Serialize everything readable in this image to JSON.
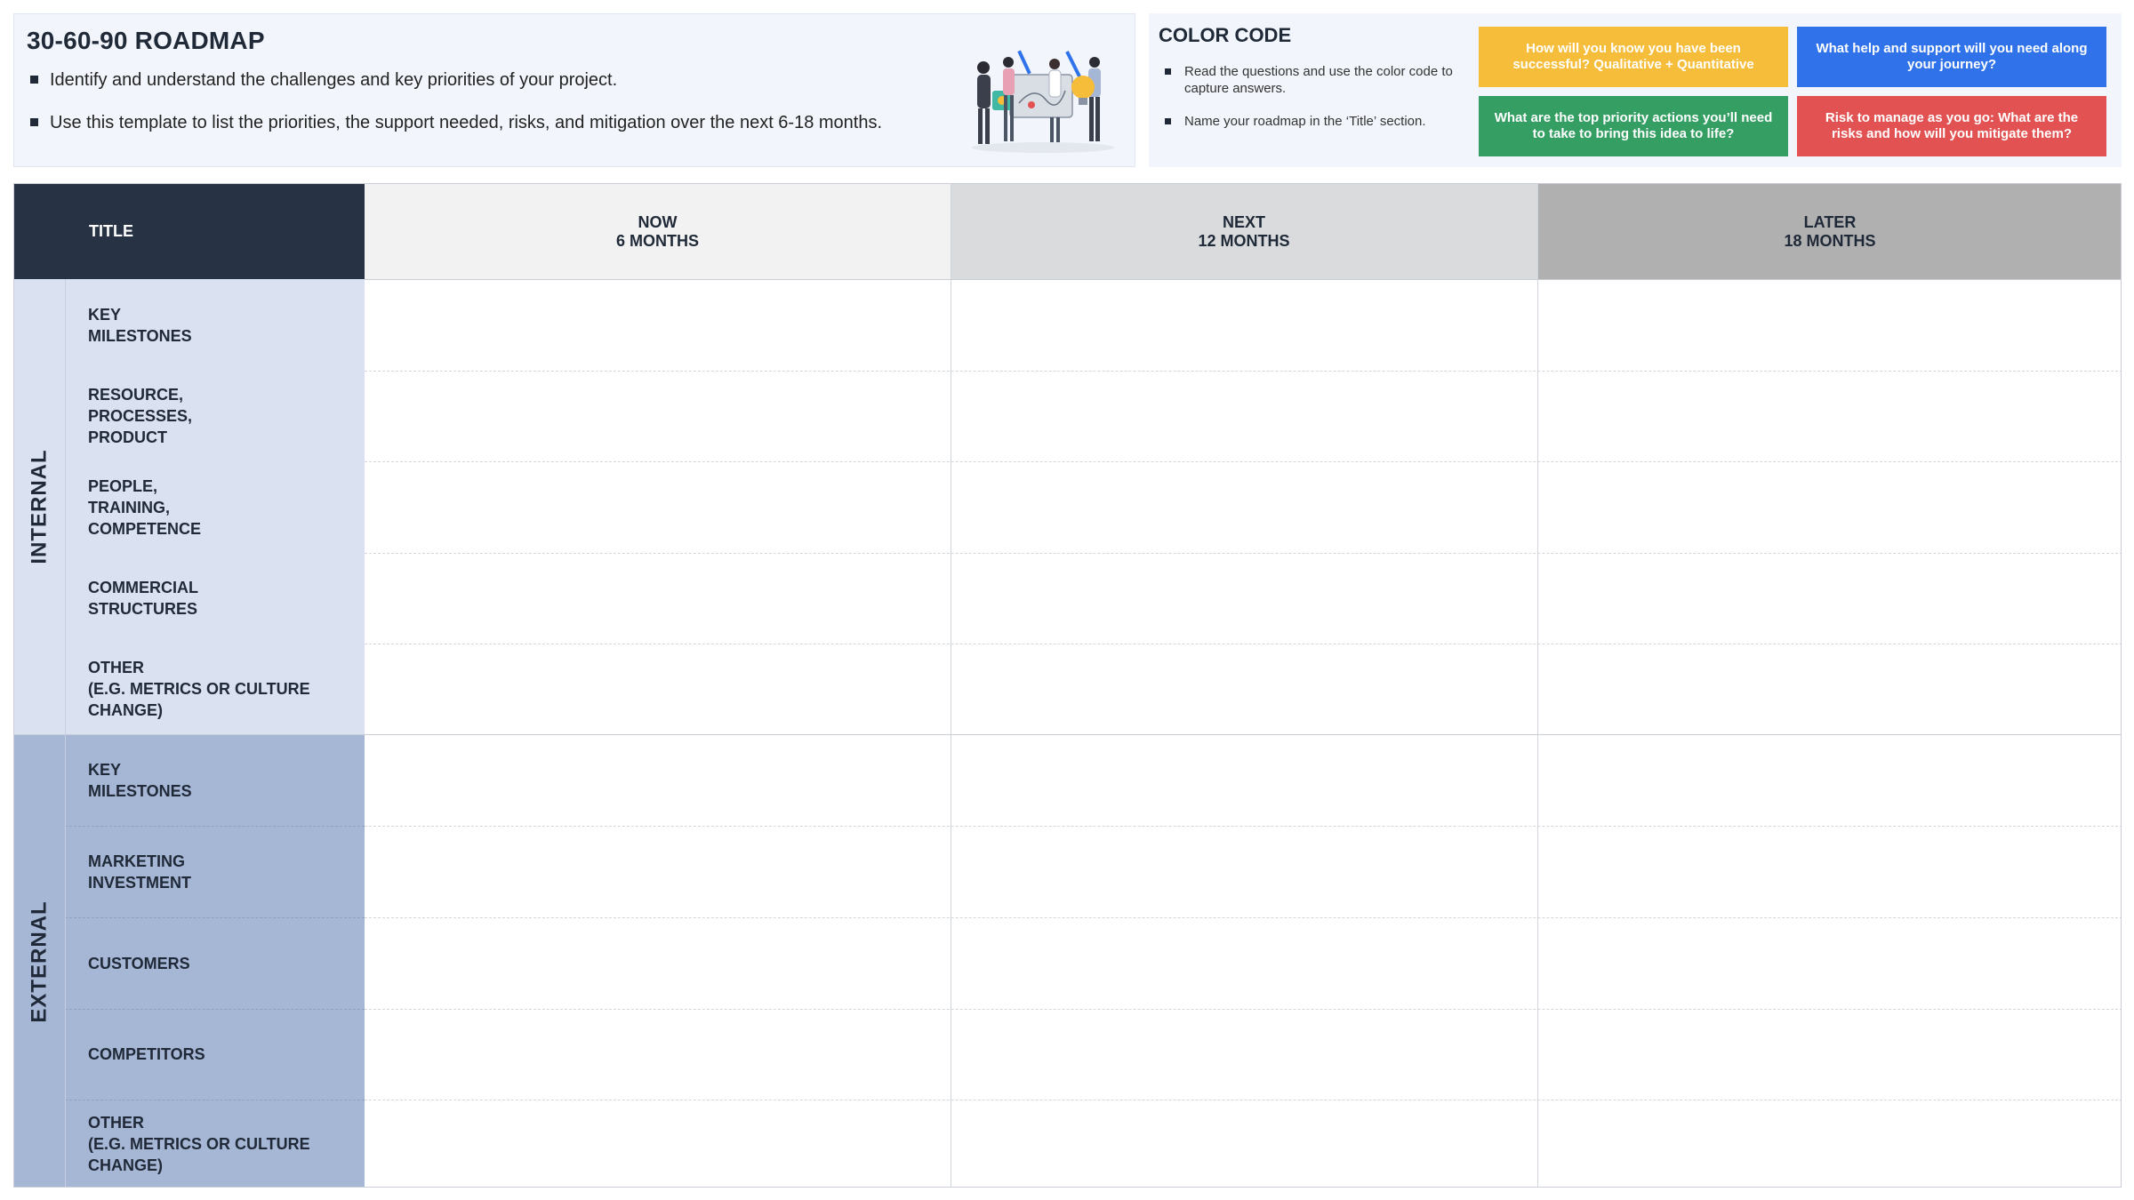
{
  "intro": {
    "title": "30-60-90 ROADMAP",
    "bullets": [
      "Identify and understand the challenges and key priorities of your project.",
      "Use this template to list the priorities, the support needed, risks, and mitigation over the next 6-18 months."
    ]
  },
  "color_code": {
    "title": "COLOR CODE",
    "bullets": [
      "Read the questions and use the color code to capture answers.",
      "Name your roadmap in the ‘Title’ section."
    ],
    "boxes": [
      {
        "text": "How will you know you have been successful? Qualitative + Quantitative",
        "color": "#f6bd3a"
      },
      {
        "text": "What help and support will you need along your journey?",
        "color": "#2f72ea"
      },
      {
        "text": "What are the top priority actions you’ll need to take to bring this idea to life?",
        "color": "#359f63"
      },
      {
        "text": "Risk to manage as you go: What are the risks and how will you mitigate them?",
        "color": "#e25252"
      }
    ]
  },
  "grid": {
    "title_label": "TITLE",
    "columns": [
      {
        "line1": "NOW",
        "line2": "6 MONTHS",
        "bg": "#f2f2f2"
      },
      {
        "line1": "NEXT",
        "line2": "12 MONTHS",
        "bg": "#dadbdc"
      },
      {
        "line1": "LATER",
        "line2": "18 MONTHS",
        "bg": "#b0b0b0"
      }
    ],
    "groups": [
      {
        "label": "INTERNAL",
        "bg": "#dae2f1",
        "rows": [
          "KEY\nMILESTONES",
          "RESOURCE,\nPROCESSES,\nPRODUCT",
          "PEOPLE,\nTRAINING,\nCOMPETENCE",
          "COMMERCIAL\nSTRUCTURES",
          "OTHER\n(E.G. METRICS OR CULTURE\nCHANGE)"
        ]
      },
      {
        "label": "EXTERNAL",
        "bg": "#a6b6d5",
        "rows": [
          "KEY\nMILESTONES",
          "MARKETING\nINVESTMENT",
          "CUSTOMERS",
          "COMPETITORS",
          "OTHER\n(E.G. METRICS OR CULTURE\nCHANGE)"
        ]
      }
    ]
  }
}
